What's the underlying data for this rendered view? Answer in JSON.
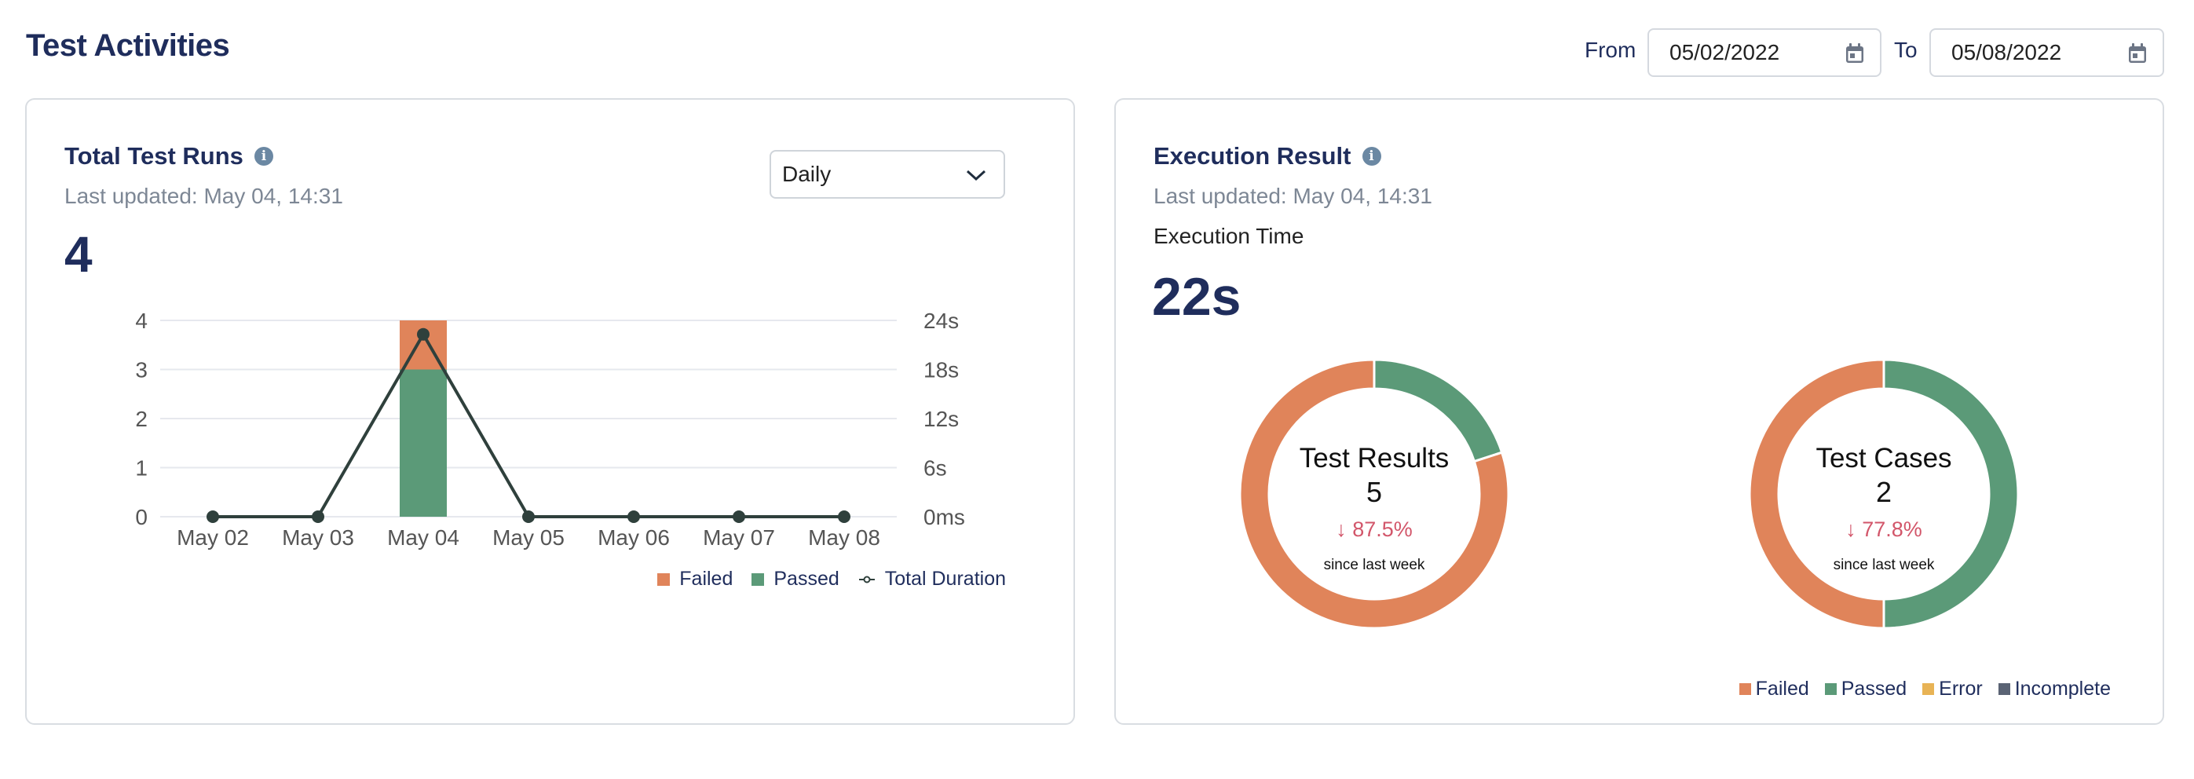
{
  "page": {
    "title": "Test Activities",
    "from_label": "From",
    "from_date": "05/02/2022",
    "to_label": "To",
    "to_date": "05/08/2022",
    "calendar_icon": "calendar-icon"
  },
  "colors": {
    "failed": "#e0845a",
    "passed": "#5b9a78",
    "error": "#e8b355",
    "incomplete": "#5a6374",
    "line": "#2f403c",
    "negative": "#d2566a",
    "title": "#1f2d5c"
  },
  "total_runs": {
    "title": "Total Test Runs",
    "info_icon": "info-icon",
    "last_updated": "Last updated: May 04, 14:31",
    "value": "4",
    "period_select": "Daily",
    "legend": [
      "Failed",
      "Passed",
      "Total Duration"
    ]
  },
  "execution": {
    "title": "Execution Result",
    "info_icon": "info-icon",
    "last_updated": "Last updated: May 04, 14:31",
    "time_label": "Execution Time",
    "time_value": "22s",
    "legend": [
      "Failed",
      "Passed",
      "Error",
      "Incomplete"
    ],
    "donuts": [
      {
        "label": "Test Results",
        "total": "5",
        "change": "↓ 87.5%",
        "since": "since last week"
      },
      {
        "label": "Test Cases",
        "total": "2",
        "change": "↓ 77.8%",
        "since": "since last week"
      }
    ]
  },
  "chart_data": [
    {
      "type": "bar",
      "title": "Total Test Runs",
      "categories": [
        "May 02",
        "May 03",
        "May 04",
        "May 05",
        "May 06",
        "May 07",
        "May 08"
      ],
      "series": [
        {
          "name": "Passed",
          "kind": "stacked-bar",
          "axis": "left",
          "values": [
            0,
            0,
            3,
            0,
            0,
            0,
            0
          ]
        },
        {
          "name": "Failed",
          "kind": "stacked-bar",
          "axis": "left",
          "values": [
            0,
            0,
            1,
            0,
            0,
            0,
            0
          ]
        },
        {
          "name": "Total Duration",
          "kind": "line",
          "axis": "right",
          "unit": "s",
          "values": [
            0,
            0,
            22.3,
            0,
            0,
            0,
            0
          ]
        }
      ],
      "ylim": [
        0,
        4
      ],
      "yticks": [
        "0",
        "1",
        "2",
        "3",
        "4"
      ],
      "y2lim": [
        0,
        24
      ],
      "y2ticks": [
        "0ms",
        "6s",
        "12s",
        "18s",
        "24s"
      ],
      "grid": true,
      "legend": "bottom-right"
    },
    {
      "type": "pie",
      "title": "Test Results",
      "donut": true,
      "slices": [
        {
          "name": "Passed",
          "value": 1
        },
        {
          "name": "Failed",
          "value": 4
        }
      ],
      "center_text": [
        "Test Results",
        "5",
        "↓ 87.5%",
        "since last week"
      ]
    },
    {
      "type": "pie",
      "title": "Test Cases",
      "donut": true,
      "slices": [
        {
          "name": "Passed",
          "value": 1
        },
        {
          "name": "Failed",
          "value": 1
        }
      ],
      "center_text": [
        "Test Cases",
        "2",
        "↓ 77.8%",
        "since last week"
      ]
    }
  ]
}
